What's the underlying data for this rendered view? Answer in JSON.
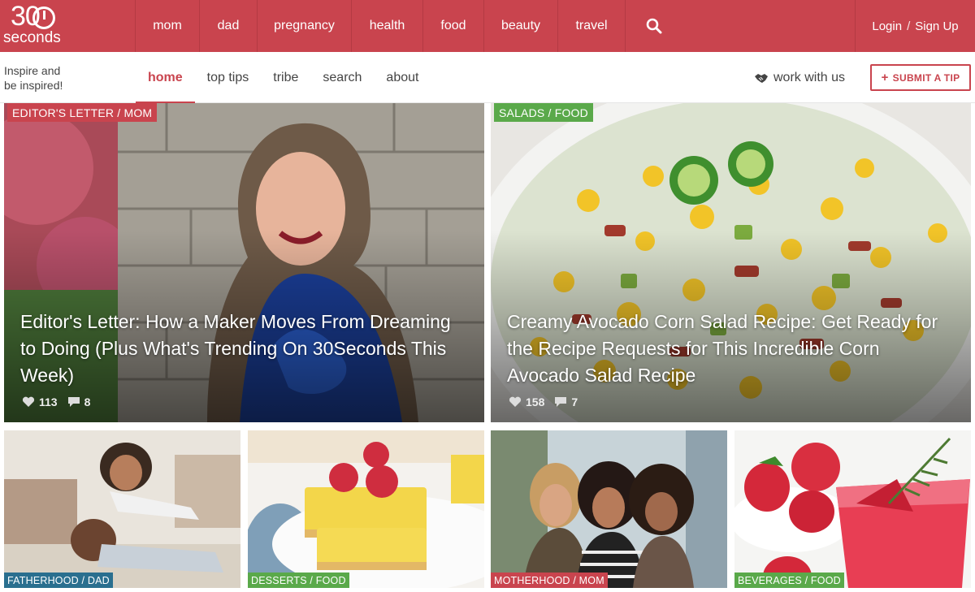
{
  "logo": {
    "number": "30",
    "word": "seconds"
  },
  "top_nav": {
    "items": [
      "mom",
      "dad",
      "pregnancy",
      "health",
      "food",
      "beauty",
      "travel"
    ],
    "search_icon": "search-icon",
    "login": "Login",
    "separator": "/",
    "signup": "Sign Up"
  },
  "sub_nav": {
    "tagline_line1": "Inspire and",
    "tagline_line2": "be inspired!",
    "items": [
      "home",
      "top tips",
      "tribe",
      "search",
      "about"
    ],
    "active": "home",
    "work_with_us": "work with us",
    "work_icon": "handshake-icon",
    "submit_plus": "+",
    "submit_label": "SUBMIT A TIP"
  },
  "featured": [
    {
      "tag": "EDITOR'S LETTER / MOM",
      "tag_color": "#c9444e",
      "title": "Editor's Letter: How a Maker Moves From Dreaming to Doing (Plus What's Trending On 30Seconds This Week)",
      "likes": "113",
      "comments": "8"
    },
    {
      "tag": "SALADS / FOOD",
      "tag_color": "#5aa94a",
      "title": "Creamy Avocado Corn Salad Recipe: Get Ready for the Recipe Requests for This Incredible Corn Avocado Salad Recipe",
      "likes": "158",
      "comments": "7"
    }
  ],
  "small_cards": [
    {
      "tag": "FATHERHOOD / DAD",
      "tag_color": "#2a6f8f"
    },
    {
      "tag": "DESSERTS / FOOD",
      "tag_color": "#5aa94a"
    },
    {
      "tag": "MOTHERHOOD / MOM",
      "tag_color": "#c9444e"
    },
    {
      "tag": "BEVERAGES / FOOD",
      "tag_color": "#5aa94a"
    }
  ],
  "colors": {
    "brand_red": "#c9444e",
    "food_green": "#5aa94a",
    "dad_blue": "#2a6f8f"
  }
}
